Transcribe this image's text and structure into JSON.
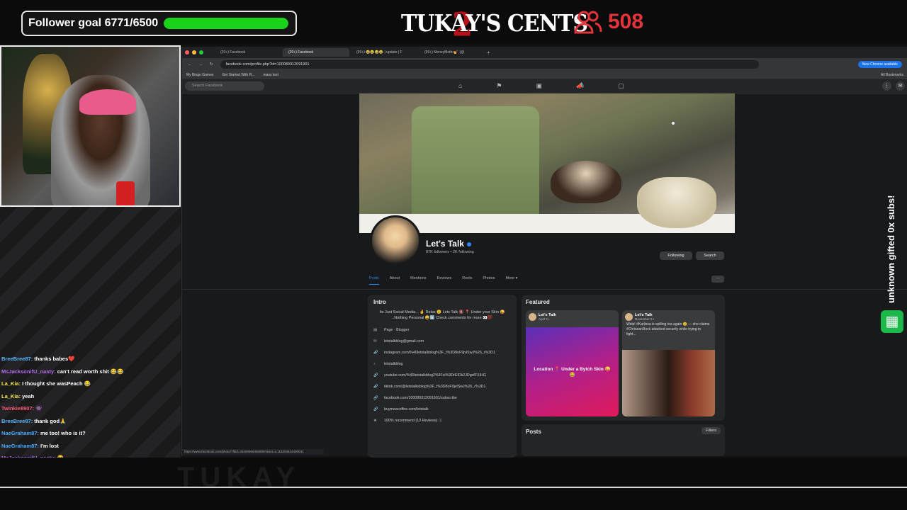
{
  "overlay": {
    "follower_goal_label": "Follower goal 6771/6500",
    "follower_goal_progress": 1.0,
    "logo_text": "TUKAY'S CENTS",
    "logo_number": "2",
    "viewer_count": "508",
    "sub_overlay_text": "unknown gifted 0x subs!",
    "watermark": "TUKAY"
  },
  "chat": [
    {
      "user": "BreeBree87:",
      "msg": "thanks babes❤️",
      "color": "#59b8ff"
    },
    {
      "user": "MsJacksonifU_nasty:",
      "msg": "can't read worth shit 😂😂",
      "color": "#b46cf0"
    },
    {
      "user": "La_Kia:",
      "msg": "I thought she wasPeach 😂",
      "color": "#f6e64a"
    },
    {
      "user": "La_Kia:",
      "msg": "yeah",
      "color": "#f6e64a"
    },
    {
      "user": "Twinkie8907:",
      "msg": "👾",
      "color": "#ff5a7a"
    },
    {
      "user": "BreeBree87:",
      "msg": "thank god🙏",
      "color": "#59b8ff"
    },
    {
      "user": "NaeGraham87:",
      "msg": "me too! who is it?",
      "color": "#4aa8ff"
    },
    {
      "user": "NaeGraham87:",
      "msg": "I'm lost",
      "color": "#4aa8ff"
    },
    {
      "user": "MsJacksonifU_nasty:",
      "msg": "😭",
      "color": "#b46cf0"
    },
    {
      "user": "MsJacksonifU_nasty:",
      "msg": "😭",
      "color": "#b46cf0"
    }
  ],
  "browser": {
    "tabs": [
      "(20+) Facebook",
      "(20+) Facebook",
      "(99+) 😂😂😂😂 | update | F",
      "(99+) MoneyMoths💅 (@"
    ],
    "url": "facebook.com/profile.php?id=100089312091901",
    "new_chrome": "New Chrome available",
    "bookmarks": [
      "My Bingo Games",
      "Get Started With R...",
      "mass text"
    ],
    "all_bookmarks": "All Bookmarks",
    "search_placeholder": "Search Facebook",
    "status_url": "https://www.facebook.com/photo/?fbid=264280664559097&set=a.118203614400041"
  },
  "profile": {
    "name": "Let's Talk",
    "stats": "87K followers • 2K following",
    "following_btn": "Following",
    "search_btn": "Search",
    "tabs": [
      "Posts",
      "About",
      "Mentions",
      "Reviews",
      "Reels",
      "Photos",
      "More ▾"
    ],
    "more_btn": "···"
  },
  "intro": {
    "title": "Intro",
    "bio": "Its Just Social Media... 🤞 Relax 😉 Lets Talk 🔇 📍 Under your Skin 😜 ..Nothing Personal 😅⬇️ Check comments for more 👀💯",
    "rows": [
      {
        "icon": "▤",
        "text": "Page · Blogger"
      },
      {
        "icon": "✉",
        "text": "letstalkblog@gmail.com"
      },
      {
        "icon": "🔗",
        "text": "instagram.com/%40letstalkblog%3F_t%3D8oF9jvlSwJ%26_r%3D1"
      },
      {
        "icon": "tiktok",
        "text": "letstalkblog"
      },
      {
        "icon": "🔗",
        "text": "youtube.com/%40letstalkblog2%3Fsi%3DrEIDk2JDgsfFXIHG"
      },
      {
        "icon": "🔗",
        "text": "tiktok.com/@letstalksblog%3F_t%3D8oF9jvlSwJ%26_r%3D1"
      },
      {
        "icon": "🔗",
        "text": "facebook.com/100089312091901/subscribe"
      },
      {
        "icon": "🔗",
        "text": "buymeacoffee.com/letstalk"
      },
      {
        "icon": "★",
        "text": "100% recommend (13 Reviews) ⓘ"
      }
    ]
  },
  "featured": {
    "title": "Featured",
    "card1": {
      "name": "Let's Talk",
      "date": "April 3 •",
      "text": "Location 📍 Under a Bytch Skin 😜😂"
    },
    "card2": {
      "name": "Let's Talk",
      "date": "November 9 •",
      "text": "Welp! #Karlissa is spilling tea again 😯 — she claims #ChriseanRock attacked security while trying to fight..."
    }
  },
  "posts": {
    "title": "Posts",
    "filters": "Filters"
  },
  "colors": {
    "accent": "#2d88ff",
    "goal_fill": "#19d219",
    "viewer_red": "#e2343a",
    "fb_bg": "#18191a",
    "card_bg": "#242526"
  }
}
